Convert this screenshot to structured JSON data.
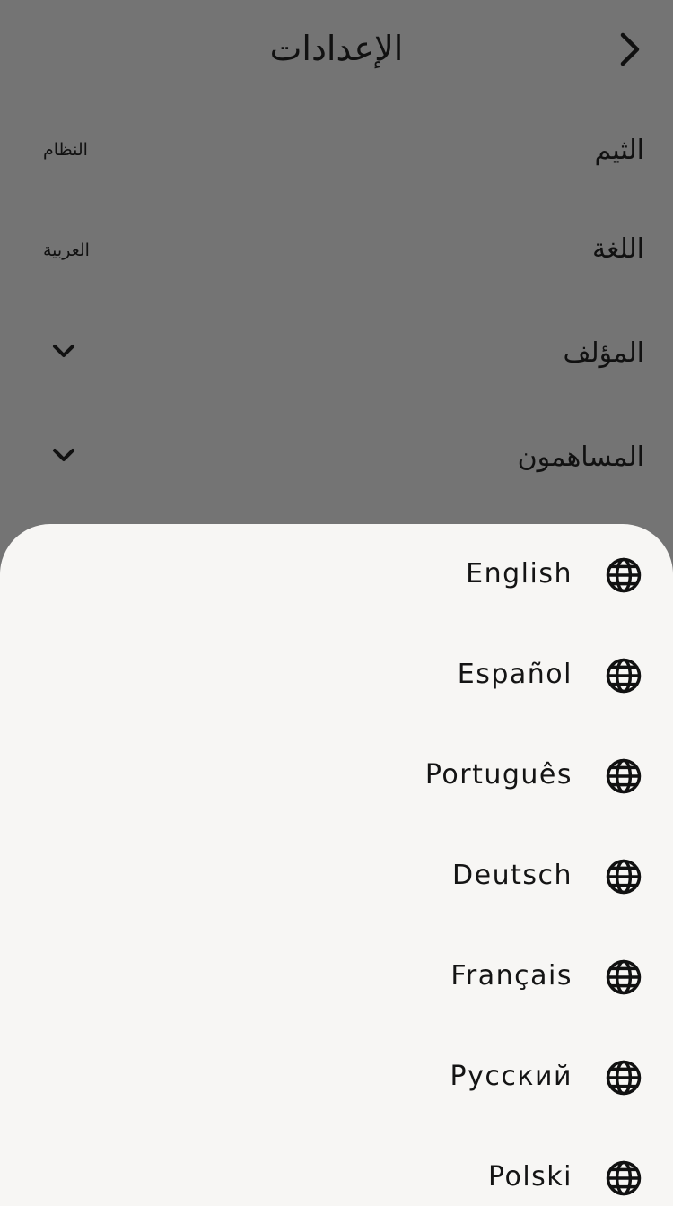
{
  "header": {
    "title": "الإعدادات",
    "back_icon": "chevron-right-icon"
  },
  "settings": {
    "theme": {
      "label": "الثيم",
      "value": "النظام"
    },
    "language": {
      "label": "اللغة",
      "value": "العربية"
    },
    "author": {
      "label": "المؤلف",
      "icon": "chevron-down-icon"
    },
    "contributors": {
      "label": "المساهمون",
      "icon": "chevron-down-icon"
    }
  },
  "language_sheet": {
    "icon": "globe-icon",
    "items": [
      {
        "label": "English"
      },
      {
        "label": "Español"
      },
      {
        "label": "Português"
      },
      {
        "label": "Deutsch"
      },
      {
        "label": "Français"
      },
      {
        "label": "Русский"
      },
      {
        "label": "Polski"
      }
    ]
  },
  "colors": {
    "overlay_background": "#747474",
    "sheet_background": "#f7f6f4",
    "text": "#111111"
  }
}
